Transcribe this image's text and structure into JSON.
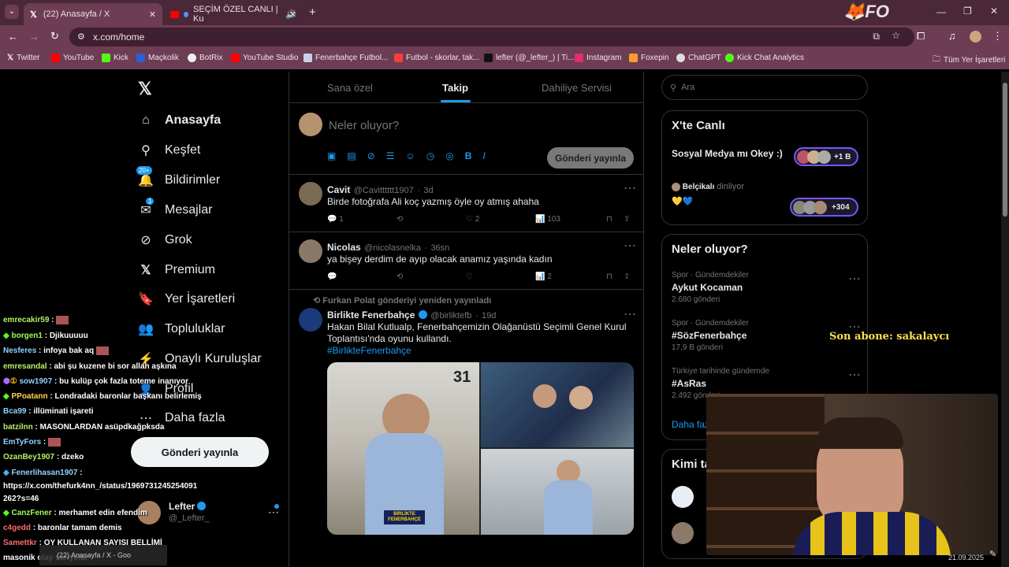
{
  "browser": {
    "tabs": [
      {
        "label": "(22) Anasayfa / X"
      },
      {
        "label": "SEÇİM ÖZEL CANLI | Ku"
      }
    ],
    "url": "x.com/home",
    "logo_text": "FO",
    "bookmarks": [
      "Twitter",
      "YouTube",
      "Kick",
      "Maçkolik",
      "BotRix",
      "YouTube Studio",
      "Fenerbahçe Futbol...",
      "Futbol - skorlar, tak...",
      "lefter (@_lefter_) | Ti...",
      "Instagram",
      "Foxepin",
      "ChatGPT",
      "Kick Chat Analytics"
    ],
    "all_bookmarks": "Tüm Yer İşaretleri"
  },
  "sidebar": {
    "items": [
      {
        "label": "Anasayfa",
        "icon": "home-icon"
      },
      {
        "label": "Keşfet",
        "icon": "search-icon"
      },
      {
        "label": "Bildirimler",
        "icon": "bell-icon",
        "badge": "20+"
      },
      {
        "label": "Mesajlar",
        "icon": "mail-icon",
        "badge": "1"
      },
      {
        "label": "Grok",
        "icon": "grok-icon"
      },
      {
        "label": "Premium",
        "icon": "x-icon"
      },
      {
        "label": "Yer İşaretleri",
        "icon": "bookmark-icon"
      },
      {
        "label": "Topluluklar",
        "icon": "people-icon"
      },
      {
        "label": "Onaylı Kuruluşlar",
        "icon": "bolt-icon"
      },
      {
        "label": "Profil",
        "icon": "person-icon"
      },
      {
        "label": "Daha fazla",
        "icon": "more-icon"
      }
    ],
    "post_button": "Gönderi yayınla",
    "user": {
      "name": "Lefter",
      "handle": "@_Lefter_"
    }
  },
  "feed": {
    "tabs": [
      "Sana özel",
      "Takip",
      "Dahiliye Servisi"
    ],
    "composer": {
      "placeholder": "Neler oluyor?",
      "button": "Gönderi yayınla"
    },
    "posts": [
      {
        "name": "Cavit",
        "handle": "@Cavitttttt1907",
        "time": "3d",
        "text": "Birde fotoğrafa Ali koç yazmış öyle oy atmış ahaha",
        "replies": "1",
        "retweets": "",
        "likes": "2",
        "views": "103"
      },
      {
        "name": "Nicolas",
        "handle": "@nicolasnelka",
        "time": "36sn",
        "text": "ya bişey derdim de ayıp olacak anamız yaşında kadın",
        "replies": "",
        "retweets": "",
        "likes": "",
        "views": "2"
      },
      {
        "repost_by": "Furkan Polat gönderiyi yeniden yayınladı",
        "name": "Birlikte Fenerbahçe",
        "handle": "@birliktefb",
        "time": "19d",
        "text": "Hakan Bilal Kutlualp, Fenerbahçemizin Olağanüstü Seçimli Genel Kurul Toplantısı'nda oyunu kullandı.",
        "hashtag": "#BirlikteFenerbahçe",
        "photo_number": "31",
        "sign_text": "BİRLİKTE FENERBAHÇE"
      }
    ]
  },
  "right": {
    "search_placeholder": "Ara",
    "live_title": "X'te Canlı",
    "live": [
      {
        "title": "Sosyal Medya mı Okey :)",
        "count": "+1 B"
      },
      {
        "title": "Belçikalı",
        "suffix": "dinliyor",
        "emoji": "💛💙",
        "count": "+304"
      }
    ],
    "trends_title": "Neler oluyor?",
    "trends": [
      {
        "cat": "Spor · Gündemdekiler",
        "name": "Aykut Kocaman",
        "posts": "2.680 gönderi"
      },
      {
        "cat": "Spor · Gündemdekiler",
        "name": "#SözFenerbahçe",
        "posts": "17,9 B gönderi"
      },
      {
        "cat": "Türkiye tarihinde gündemde",
        "name": "#AsRas",
        "posts": "2.492 gönderi"
      }
    ],
    "show_more": "Daha fazla göster",
    "who_title": "Kimi takip etmeli"
  },
  "overlay": {
    "sub_text": "Son abone: sakalaycı",
    "chat": [
      {
        "user": "emrecakir59",
        "msg": "",
        "color": "#b6f06a"
      },
      {
        "user": "borgen1",
        "msg": "Djikuuuuu",
        "color": "#9dff5a"
      },
      {
        "user": "Nesferes",
        "msg": "infoya bak aq",
        "color": "#8fd3ff"
      },
      {
        "user": "emresandal",
        "msg": "abi şu kuzene bi sor allah aşkına",
        "color": "#b6f06a"
      },
      {
        "user": "sow1907",
        "msg": "bu kulüp çok fazla toteme inanıyor",
        "color": "#8fd3ff"
      },
      {
        "user": "PPoatann",
        "msg": "Londradaki baronlar başkanı belirlemiş",
        "color": "#ffd54a"
      },
      {
        "user": "Bca99",
        "msg": "illüminati işareti",
        "color": "#8fd3ff"
      },
      {
        "user": "batzilnn",
        "msg": "MASONLARDAN asüpdkağpksda",
        "color": "#b6f06a"
      },
      {
        "user": "EmTyFors",
        "msg": "",
        "color": "#8fd3ff"
      },
      {
        "user": "OzanBey1907",
        "msg": "dzeko",
        "color": "#b6f06a"
      },
      {
        "user": "Fenerlihasan1907",
        "msg": "",
        "color": "#8fd3ff"
      },
      {
        "user": "",
        "msg": "https://x.com/thefurk4nn_/status/1969731245254091",
        "color": "#fff"
      },
      {
        "user": "",
        "msg": "262?s=46",
        "color": "#fff"
      },
      {
        "user": "CanzFener",
        "msg": "merhamet edin efendim",
        "color": "#9dff5a"
      },
      {
        "user": "c4gedd",
        "msg": "baronlar tamam demis",
        "color": "#ff6b6b"
      },
      {
        "user": "Samettkr",
        "msg": "OY KULLANAN SAYISI BELLİMİ",
        "color": "#ff6b6b"
      },
      {
        "user": "",
        "msg": "masonik olay sarıyolar",
        "color": "#fff"
      }
    ],
    "taskbar_item": "(22) Anasayfa / X - Goo",
    "date": "21.09.2025"
  }
}
